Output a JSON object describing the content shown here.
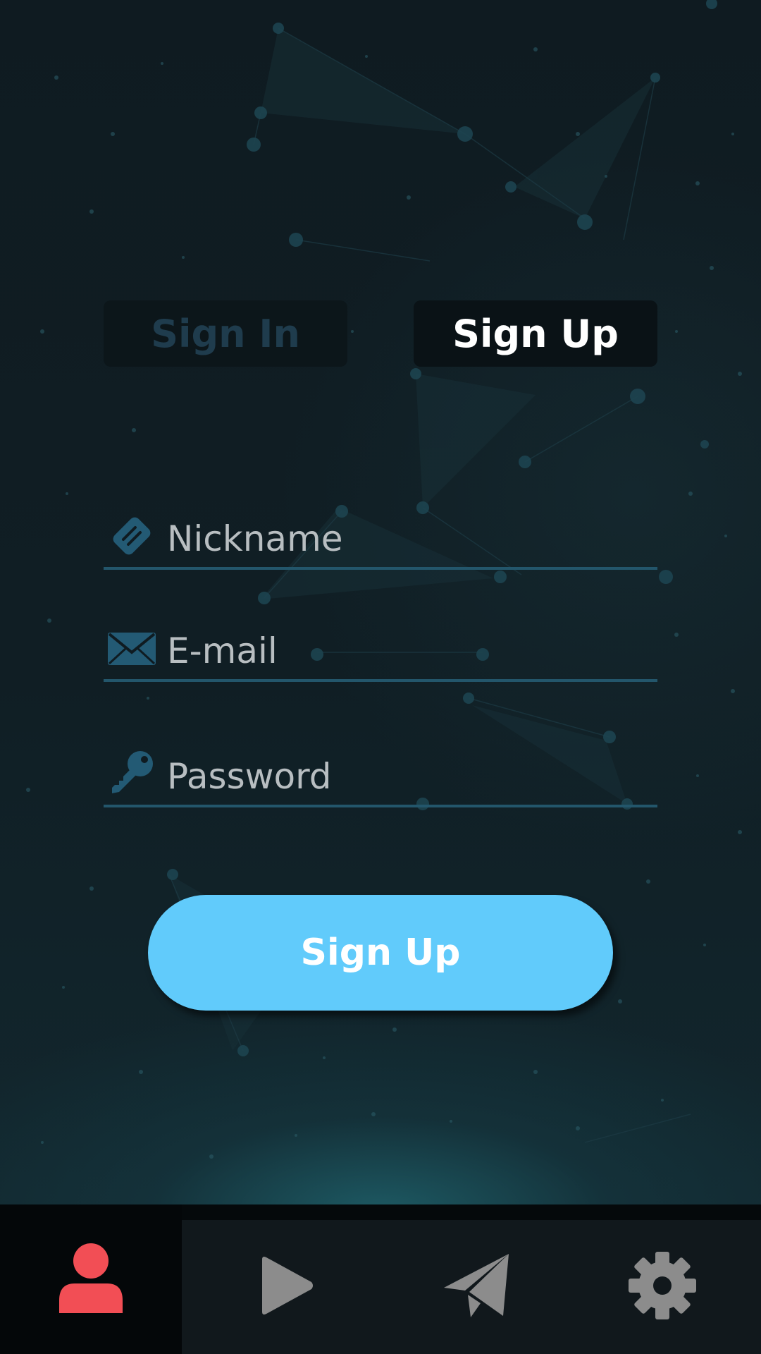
{
  "auth_tabs": {
    "sign_in_label": "Sign In",
    "sign_up_label": "Sign Up",
    "active": "sign_up"
  },
  "form": {
    "nickname": {
      "placeholder": "Nickname",
      "value": "",
      "icon": "tag-icon"
    },
    "email": {
      "placeholder": "E-mail",
      "value": "",
      "icon": "envelope-icon"
    },
    "password": {
      "placeholder": "Password",
      "value": "",
      "icon": "key-icon"
    },
    "submit_label": "Sign Up"
  },
  "bottom_nav": {
    "items": [
      {
        "name": "profile",
        "icon": "user-icon",
        "active": true
      },
      {
        "name": "play",
        "icon": "play-icon",
        "active": false
      },
      {
        "name": "send",
        "icon": "paper-plane-icon",
        "active": false
      },
      {
        "name": "settings",
        "icon": "gear-icon",
        "active": false
      }
    ]
  },
  "colors": {
    "background": "#0f1b21",
    "accent": "#61cbfb",
    "field_underline": "#23566b",
    "icon_muted": "#235a74",
    "nav_active_icon": "#f24e55",
    "nav_inactive_icon": "#8c8c8c"
  }
}
